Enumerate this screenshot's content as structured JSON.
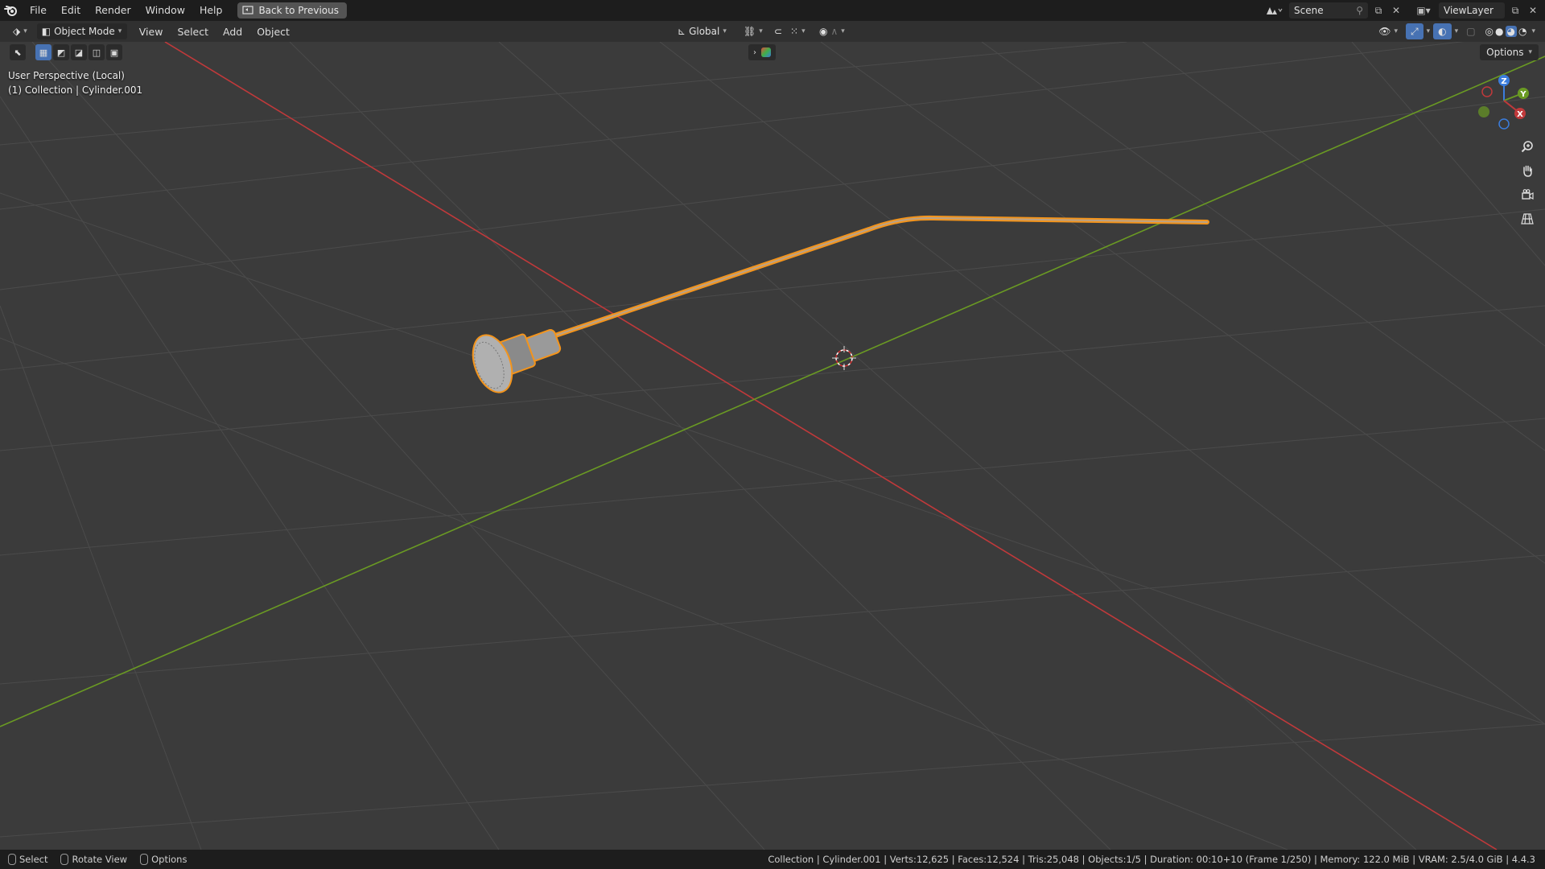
{
  "topbar": {
    "menu": [
      "File",
      "Edit",
      "Render",
      "Window",
      "Help"
    ],
    "back_label": "Back to Previous",
    "scene_name": "Scene",
    "view_layer": "ViewLayer"
  },
  "header": {
    "mode": "Object Mode",
    "menus": [
      "View",
      "Select",
      "Add",
      "Object"
    ],
    "transform_orientation": "Global"
  },
  "viewport": {
    "view_name": "User Perspective (Local)",
    "collection_info": "(1) Collection | Cylinder.001",
    "options_label": "Options",
    "gizmo": {
      "z": "Z",
      "y": "Y",
      "x": "X"
    }
  },
  "statusbar": {
    "select": "Select",
    "rotate": "Rotate View",
    "options": "Options",
    "stats": "Collection | Cylinder.001 | Verts:12,625 | Faces:12,524 | Tris:25,048 | Objects:1/5 | Duration: 00:10+10 (Frame 1/250) | Memory: 122.0 MiB | VRAM: 2.5/4.0 GiB | 4.4.3"
  },
  "colors": {
    "x_axis": "#c0393b",
    "y_axis": "#6a9a23",
    "selection": "#f3941c",
    "active_tool": "#4772b3"
  }
}
